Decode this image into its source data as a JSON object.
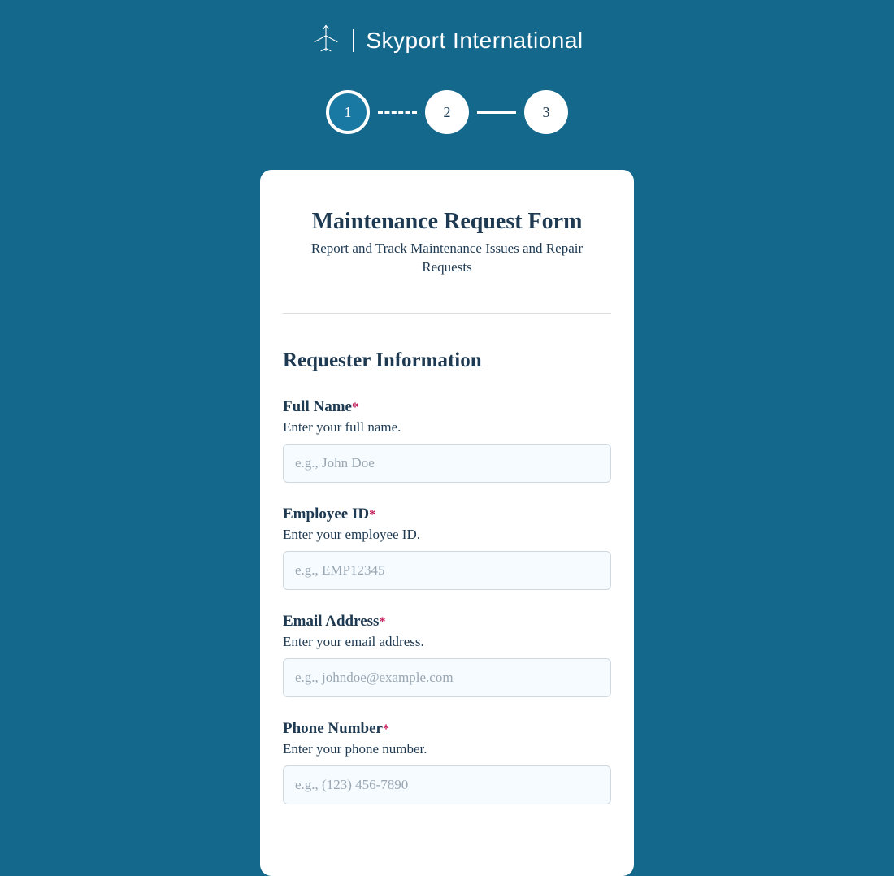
{
  "brand": {
    "name": "Skyport International"
  },
  "steps": {
    "items": [
      {
        "label": "1",
        "active": true
      },
      {
        "label": "2",
        "active": false
      },
      {
        "label": "3",
        "active": false
      }
    ]
  },
  "form": {
    "title": "Maintenance Request Form",
    "subtitle": "Report and Track Maintenance Issues and Repair Requests",
    "section_title": "Requester Information",
    "required_mark": "*",
    "fields": {
      "full_name": {
        "label": "Full Name",
        "hint": "Enter your full name.",
        "placeholder": "e.g., John Doe",
        "value": ""
      },
      "employee_id": {
        "label": "Employee ID",
        "hint": "Enter your employee ID.",
        "placeholder": "e.g., EMP12345",
        "value": ""
      },
      "email": {
        "label": "Email Address",
        "hint": "Enter your email address.",
        "placeholder": "e.g., johndoe@example.com",
        "value": ""
      },
      "phone": {
        "label": "Phone Number",
        "hint": "Enter your phone number.",
        "placeholder": "e.g., (123) 456-7890",
        "value": ""
      }
    }
  }
}
